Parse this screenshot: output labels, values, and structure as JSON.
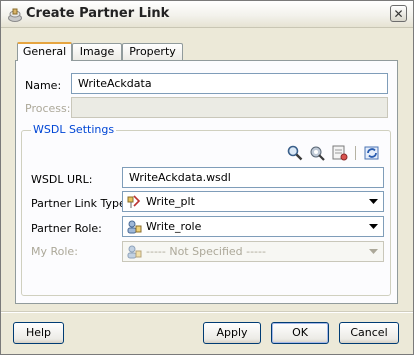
{
  "window": {
    "title": "Create Partner Link",
    "close_glyph": "✕"
  },
  "tabs": [
    {
      "label": "General",
      "active": true
    },
    {
      "label": "Image",
      "active": false
    },
    {
      "label": "Property",
      "active": false
    }
  ],
  "form": {
    "name_label": "Name:",
    "name_value": "WriteAckdata",
    "process_label": "Process:",
    "process_value": "",
    "wsdl_group_title": "WSDL Settings",
    "wsdl_url_label": "WSDL URL:",
    "wsdl_url_value": "WriteAckdata.wsdl",
    "partner_link_type_label": "Partner Link Type:",
    "partner_link_type_value": "Write_plt",
    "partner_role_label": "Partner Role:",
    "partner_role_value": "Write_role",
    "my_role_label": "My Role:",
    "my_role_value": "----- Not Specified -----"
  },
  "toolbar_icons": [
    "search-icon",
    "service-explorer-icon",
    "wsdl-browse-icon",
    "refresh-icon"
  ],
  "buttons": {
    "help": "Help",
    "apply": "Apply",
    "ok": "OK",
    "cancel": "Cancel"
  },
  "colors": {
    "accent_tab": "#e6a541",
    "group_title": "#0046d5",
    "dialog_bg": "#ece9d8"
  }
}
